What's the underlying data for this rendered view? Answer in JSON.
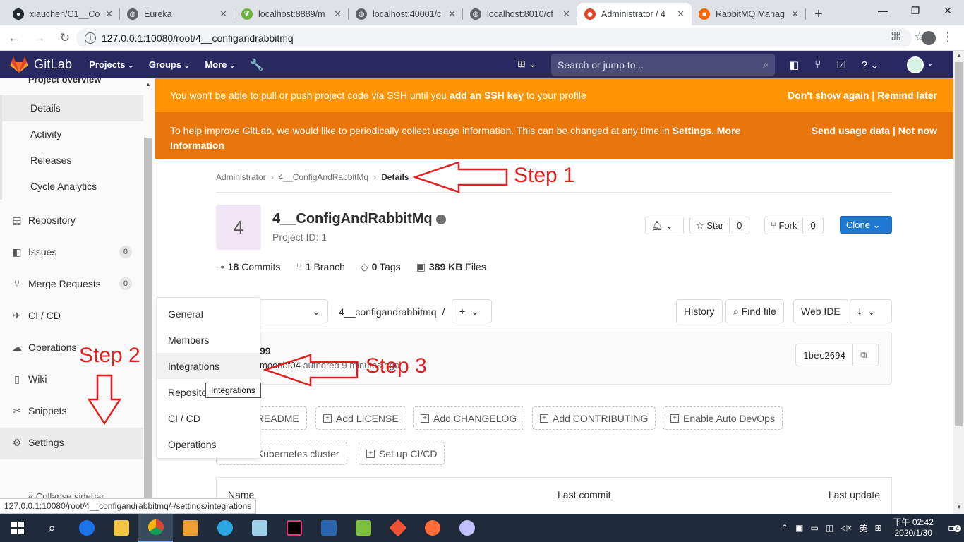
{
  "browser": {
    "tabs": [
      {
        "title": "xiauchen/C1__Co",
        "color": "#24292e",
        "glyph": "●"
      },
      {
        "title": "Eureka",
        "color": "#5f6368",
        "glyph": "◍"
      },
      {
        "title": "localhost:8889/m",
        "color": "#6db33f",
        "glyph": "❦"
      },
      {
        "title": "localhost:40001/c",
        "color": "#5f6368",
        "glyph": "◍"
      },
      {
        "title": "localhost:8010/cf",
        "color": "#5f6368",
        "glyph": "◍"
      },
      {
        "title": "Administrator / 4",
        "color": "#e24329",
        "glyph": "◆"
      },
      {
        "title": "RabbitMQ Manag",
        "color": "#ff6600",
        "glyph": "■"
      }
    ],
    "url": "127.0.0.1:10080/root/4__configandrabbitmq"
  },
  "gitlab": {
    "brand": "GitLab",
    "nav": [
      "Projects",
      "Groups",
      "More"
    ],
    "search_placeholder": "Search or jump to..."
  },
  "sidebar": {
    "overview": "Project overview",
    "sub_items": [
      "Details",
      "Activity",
      "Releases",
      "Cycle Analytics"
    ],
    "items": [
      {
        "label": "Repository",
        "icon": "book-icon",
        "glyph": "▤"
      },
      {
        "label": "Issues",
        "icon": "issues-icon",
        "glyph": "◧",
        "count": "0"
      },
      {
        "label": "Merge Requests",
        "icon": "merge-request-icon",
        "glyph": "⑂",
        "count": "0"
      },
      {
        "label": "CI / CD",
        "icon": "rocket-icon",
        "glyph": "✈"
      },
      {
        "label": "Operations",
        "icon": "cloud-gear-icon",
        "glyph": "☁"
      },
      {
        "label": "Wiki",
        "icon": "wiki-book-icon",
        "glyph": "▯"
      },
      {
        "label": "Snippets",
        "icon": "scissors-icon",
        "glyph": "✂"
      },
      {
        "label": "Settings",
        "icon": "gear-icon",
        "glyph": "⚙"
      }
    ],
    "collapse": "Collapse sidebar"
  },
  "flyout": {
    "items": [
      "General",
      "Members",
      "Integrations",
      "Repository",
      "CI / CD",
      "Operations"
    ],
    "tooltip": "Integrations"
  },
  "status_url": "127.0.0.1:10080/root/4__configandrabbitmq/-/settings/integrations",
  "alerts": {
    "ssh_pre": "You won't be able to pull or push project code via SSH until you ",
    "ssh_link": "add an SSH key",
    "ssh_post": " to your profile",
    "ssh_actions": "Don't show again | Remind later",
    "usage_pre": "To help improve GitLab, we would like to periodically collect usage information. This can be changed at any time in ",
    "usage_settings": "Settings",
    "usage_more": ". More Information",
    "usage_actions": "Send usage data | Not now"
  },
  "breadcrumbs": [
    "Administrator",
    "4__ConfigAndRabbitMq",
    "Details"
  ],
  "project": {
    "avatar_letter": "4",
    "name": "4__ConfigAndRabbitMq",
    "id_label": "Project ID: 1",
    "star_label": "Star",
    "star_count": "0",
    "fork_label": "Fork",
    "fork_count": "0",
    "clone_label": "Clone"
  },
  "stats": [
    {
      "value": "18",
      "label": "Commits",
      "glyph": "⊸"
    },
    {
      "value": "1",
      "label": "Branch",
      "glyph": "⑂"
    },
    {
      "value": "0",
      "label": "Tags",
      "glyph": "◇"
    },
    {
      "value": "389 KB",
      "label": "Files",
      "glyph": "▣"
    }
  ],
  "repo": {
    "path": "4__configandrabbitmq",
    "path_sep": "/",
    "history": "History",
    "find_file": "Find file",
    "web_ide": "Web IDE"
  },
  "commit": {
    "title": "99",
    "author": "moonbt04",
    "meta": " authored 9 minutes ago",
    "sha": "1bec2694"
  },
  "suggest_buttons": [
    "Add README",
    "Add LICENSE",
    "Add CHANGELOG",
    "Add CONTRIBUTING",
    "Enable Auto DevOps",
    "Add Kubernetes cluster",
    "Set up CI/CD"
  ],
  "table_headers": [
    "Name",
    "Last commit",
    "Last update"
  ],
  "annotations": [
    "Step 1",
    "Step 2",
    "Step 3"
  ],
  "taskbar": {
    "time": "下午 02:42",
    "date": "2020/1/30",
    "ime": "英",
    "notif_count": "4"
  },
  "colors": {
    "gitlab_header": "#292961",
    "alert_orange": "#fc9403",
    "alert_dark_orange": "#e8760c",
    "clone_blue": "#1f78d1",
    "annotation_red": "#e02020"
  }
}
